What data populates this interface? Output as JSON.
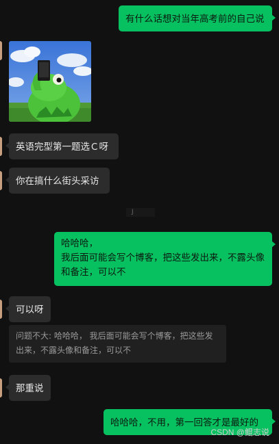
{
  "colors": {
    "background": "#111111",
    "incoming_bubble": "#2c2c2c",
    "outgoing_bubble": "#07c160"
  },
  "messages": [
    {
      "side": "out",
      "text": "有什么话想对当年高考前的自己说"
    },
    {
      "side": "in",
      "type": "sticker",
      "sticker": "kermit-frog-holding-phone-sticker"
    },
    {
      "side": "in",
      "text": "英语完型第一题选Ｃ呀"
    },
    {
      "side": "in",
      "text": "你在搞什么街头采访"
    },
    {
      "side": "out",
      "text": "哈哈哈，\n我后面可能会写个博客，把这些发出来，不露头像和备注，可以不"
    },
    {
      "side": "in",
      "text": "可以呀"
    },
    {
      "side": "in",
      "text": "那重说"
    },
    {
      "side": "out",
      "text": "哈哈哈，不用，第一回答才是最好的"
    }
  ],
  "timestamp": "J",
  "quote": {
    "text": "问题不大: 哈哈哈， 我后面可能会写个博客，把这些发出来，不露头像和备注，可以不"
  },
  "watermark": "CSDN @鲲志说"
}
